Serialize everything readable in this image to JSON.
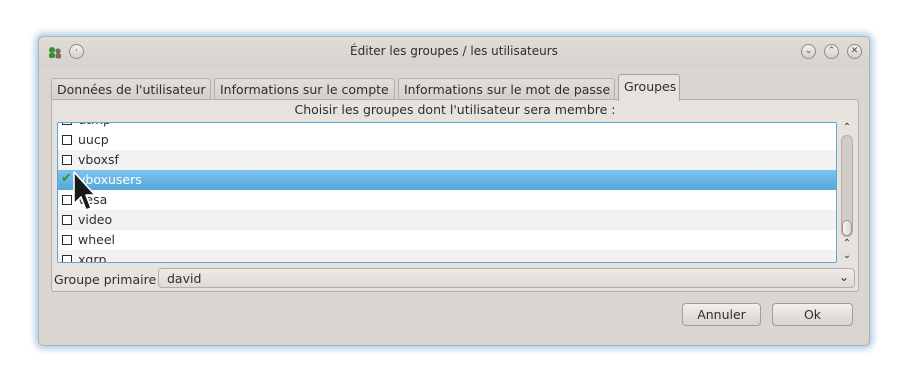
{
  "window": {
    "title": "Éditer les groupes / les utilisateurs"
  },
  "titlebar_buttons": {
    "menu_symbol": "·",
    "minimize_symbol": "⌄",
    "maximize_symbol": "⌃",
    "close_symbol": "✕"
  },
  "tabs": [
    {
      "label": "Données de l'utilisateur",
      "active": false
    },
    {
      "label": "Informations sur le compte",
      "active": false
    },
    {
      "label": "Informations sur le mot de passe",
      "active": false
    },
    {
      "label": "Groupes",
      "active": true
    }
  ],
  "groups_panel": {
    "instruction": "Choisir les groupes dont l'utilisateur sera membre :",
    "partial_top_item": "utmp",
    "items": [
      {
        "label": "uucp",
        "checked": false
      },
      {
        "label": "vboxsf",
        "checked": false
      },
      {
        "label": "vboxusers",
        "checked": true,
        "selected": true
      },
      {
        "label": "vesa",
        "checked": false
      },
      {
        "label": "video",
        "checked": false
      },
      {
        "label": "wheel",
        "checked": false
      },
      {
        "label": "xgrp",
        "checked": false
      }
    ],
    "checkmark_symbol": "✔",
    "scroll_up_symbol": "⌃",
    "scroll_down_symbol": "⌄"
  },
  "primary_group": {
    "label": "Groupe primaire",
    "value": "david",
    "dropdown_symbol": "⌄"
  },
  "buttons": {
    "cancel": "Annuler",
    "ok": "Ok"
  },
  "colors": {
    "selection": "#56a8da",
    "focus_border": "#5fa6d6",
    "window_bg": "#d9d5d1",
    "checkmark": "#2f8f3a"
  }
}
